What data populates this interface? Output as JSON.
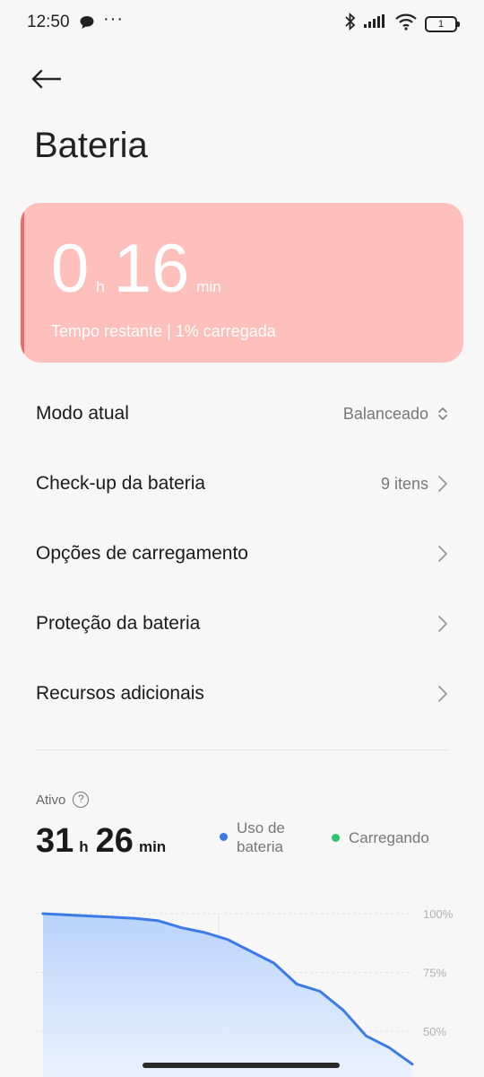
{
  "status_bar": {
    "time": "12:50",
    "dots": "···",
    "battery_level": "1"
  },
  "header": {
    "title": "Bateria"
  },
  "battery_card": {
    "hours": "0",
    "hours_unit": "h",
    "minutes": "16",
    "minutes_unit": "min",
    "subtitle": "Tempo restante | 1% carregada",
    "bg_color": "#ffc0bb",
    "accent_color": "#f0686a"
  },
  "settings": [
    {
      "label": "Modo atual",
      "value": "Balanceado",
      "icon": "unfold-icon"
    },
    {
      "label": "Check-up da bateria",
      "value": "9 itens",
      "icon": "chevron-right-icon"
    },
    {
      "label": "Opções de carregamento",
      "value": "",
      "icon": "chevron-right-icon"
    },
    {
      "label": "Proteção da bateria",
      "value": "",
      "icon": "chevron-right-icon"
    },
    {
      "label": "Recursos adicionais",
      "value": "",
      "icon": "chevron-right-icon"
    }
  ],
  "usage": {
    "label": "Ativo",
    "hours": "31",
    "hours_unit": "h",
    "minutes": "26",
    "minutes_unit": "min",
    "legend_usage_line1": "Uso de",
    "legend_usage_line2": "bateria",
    "legend_charging": "Carregando",
    "usage_color": "#3a7be8",
    "charging_color": "#2ec46b"
  },
  "chart_data": {
    "type": "area",
    "series": [
      {
        "name": "Uso de bateria",
        "x": [
          0,
          2,
          4,
          5,
          6,
          7,
          8,
          10,
          11,
          12,
          13,
          14,
          15,
          16
        ],
        "values": [
          100,
          99,
          98,
          97,
          94,
          92,
          89,
          79,
          70,
          67,
          59,
          48,
          43,
          36
        ]
      }
    ],
    "y_ticks": [
      "100%",
      "75%",
      "50%"
    ],
    "ylim": [
      0,
      100
    ],
    "grid": true
  }
}
